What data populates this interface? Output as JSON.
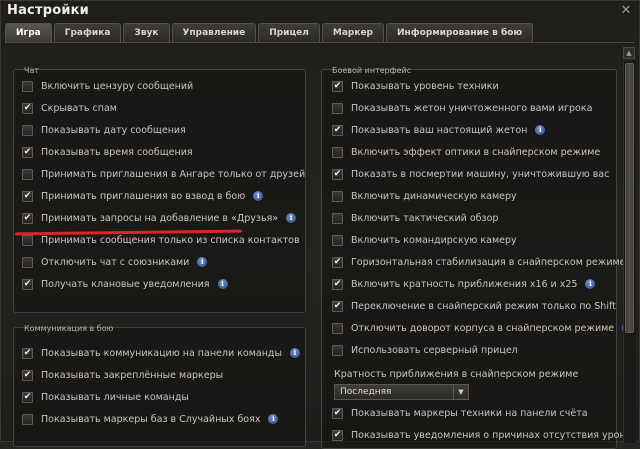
{
  "window": {
    "title": "Настройки"
  },
  "tabs": [
    {
      "label": "Игра"
    },
    {
      "label": "Графика"
    },
    {
      "label": "Звук"
    },
    {
      "label": "Управление"
    },
    {
      "label": "Прицел"
    },
    {
      "label": "Маркер"
    },
    {
      "label": "Информирование в бою"
    }
  ],
  "chat": {
    "title": "Чат",
    "items": [
      {
        "label": "Включить цензуру сообщений",
        "checked": false,
        "info": false
      },
      {
        "label": "Скрывать спам",
        "checked": true,
        "info": false
      },
      {
        "label": "Показывать дату сообщения",
        "checked": false,
        "info": false
      },
      {
        "label": "Показывать время сообщения",
        "checked": true,
        "info": false
      },
      {
        "label": "Принимать приглашения в Ангаре только от друзей",
        "checked": false,
        "info": false
      },
      {
        "label": "Принимать приглашения во взвод в бою",
        "checked": true,
        "info": true
      },
      {
        "label": "Принимать запросы на добавление в «Друзья»",
        "checked": true,
        "info": true
      },
      {
        "label": "Принимать сообщения только из списка контактов",
        "checked": false,
        "info": false
      },
      {
        "label": "Отключить чат с союзниками",
        "checked": false,
        "info": true
      },
      {
        "label": "Получать клановые уведомления",
        "checked": true,
        "info": true
      }
    ]
  },
  "communication": {
    "title": "Коммуникация в бою",
    "items": [
      {
        "label": "Показывать коммуникацию на панели команды",
        "checked": true,
        "info": true
      },
      {
        "label": "Показывать закреплённые маркеры",
        "checked": true,
        "info": false
      },
      {
        "label": "Показывать личные команды",
        "checked": true,
        "info": false
      },
      {
        "label": "Показывать маркеры баз в Случайных боях",
        "checked": false,
        "info": true
      }
    ]
  },
  "battle_interface": {
    "title": "Боевой интерфейс",
    "items": [
      {
        "label": "Показывать уровень техники",
        "checked": true,
        "info": false
      },
      {
        "label": "Показывать жетон уничтоженного вами игрока",
        "checked": false,
        "info": false
      },
      {
        "label": "Показывать ваш настоящий жетон",
        "checked": true,
        "info": true
      },
      {
        "label": "Включить эффект оптики в снайперском режиме",
        "checked": false,
        "info": false
      },
      {
        "label": "Показать в посмертии машину, уничтожившую вас",
        "checked": true,
        "info": false
      },
      {
        "label": "Включить динамическую камеру",
        "checked": false,
        "info": false
      },
      {
        "label": "Включить тактический обзор",
        "checked": false,
        "info": false
      },
      {
        "label": "Включить командирскую камеру",
        "checked": false,
        "info": false
      },
      {
        "label": "Горизонтальная стабилизация в снайперском режиме",
        "checked": true,
        "info": false
      },
      {
        "label": "Включить кратность приближения x16 и x25",
        "checked": true,
        "info": true
      },
      {
        "label": "Переключение в снайперский режим только по Shift",
        "checked": true,
        "info": false
      },
      {
        "label": "Отключить доворот корпуса в снайперском режиме",
        "checked": false,
        "info": true
      },
      {
        "label": "Использовать серверный прицел",
        "checked": false,
        "info": false
      }
    ],
    "zoom_label": "Кратность приближения в снайперском режиме",
    "zoom_value": "Последняя",
    "items_after": [
      {
        "label": "Показывать маркеры техники на панели счёта",
        "checked": true,
        "info": false
      },
      {
        "label": "Показывать уведомления о причинах отсутствия урона",
        "checked": true,
        "info": true
      }
    ]
  },
  "check_mark": "✔",
  "info_mark": "i",
  "close_glyph": "✕",
  "colors": {
    "accent_red": "#d8262a",
    "info_blue": "#3a63b0"
  }
}
